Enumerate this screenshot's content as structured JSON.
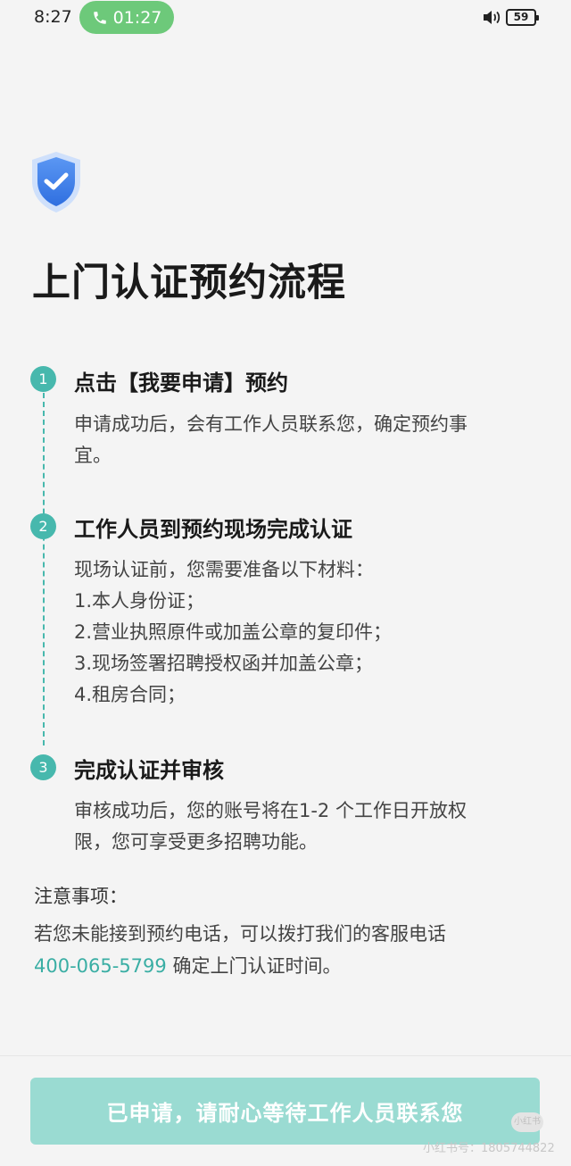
{
  "status_bar": {
    "time": "8:27",
    "call_duration": "01:27",
    "battery": "59",
    "icons": [
      "phone-icon",
      "speaker-icon",
      "battery-icon"
    ]
  },
  "header": {
    "icon": "shield-check-icon",
    "title": "上门认证预约流程"
  },
  "steps": [
    {
      "number": "1",
      "title": "点击【我要申请】预约",
      "lines": [
        "申请成功后，会有工作人员联系您，确定预约事",
        "宜。"
      ]
    },
    {
      "number": "2",
      "title": "工作人员到预约现场完成认证",
      "lines": [
        "现场认证前，您需要准备以下材料：",
        "1.本人身份证；",
        "2.营业执照原件或加盖公章的复印件；",
        "3.现场签署招聘授权函并加盖公章；",
        "4.租房合同；"
      ]
    },
    {
      "number": "3",
      "title": "完成认证并审核",
      "lines": [
        "审核成功后，您的账号将在1-2 个工作日开放权",
        "限，您可享受更多招聘功能。"
      ]
    }
  ],
  "notice": {
    "title": "注意事项：",
    "text_before": "若您未能接到预约电话，可以拨打我们的客服电话",
    "phone": "400-065-5799",
    "text_after": " 确定上门认证时间。"
  },
  "footer": {
    "button_label": "已申请，请耐心等待工作人员联系您",
    "watermark": "小红书号：1805744822",
    "watermark_badge": "小红书"
  },
  "colors": {
    "accent": "#47b8ad",
    "button": "#9adbd2",
    "call_pill": "#6dc97a",
    "shield": "#3f7ee8"
  }
}
